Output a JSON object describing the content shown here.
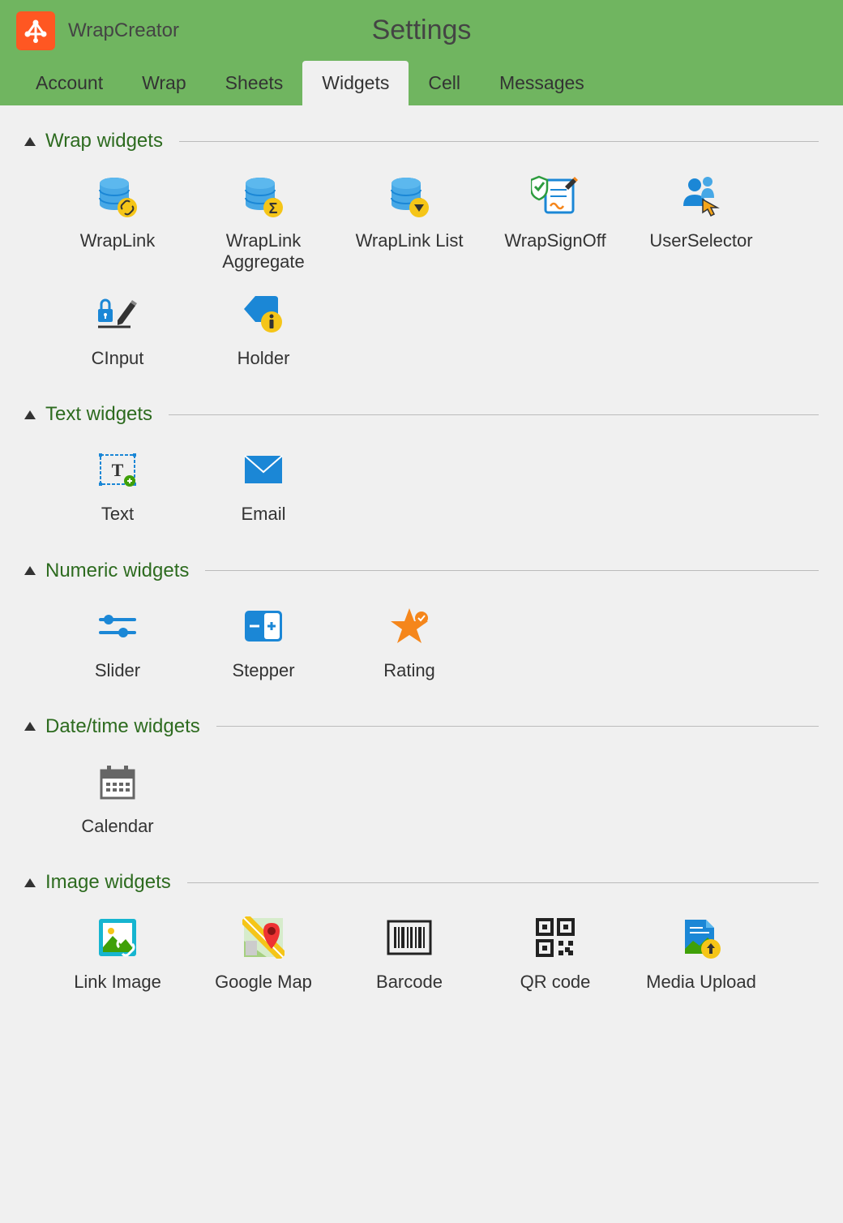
{
  "header": {
    "app_name": "WrapCreator",
    "page_title": "Settings"
  },
  "tabs": [
    {
      "label": "Account",
      "active": false
    },
    {
      "label": "Wrap",
      "active": false
    },
    {
      "label": "Sheets",
      "active": false
    },
    {
      "label": "Widgets",
      "active": true
    },
    {
      "label": "Cell",
      "active": false
    },
    {
      "label": "Messages",
      "active": false
    }
  ],
  "sections": [
    {
      "title": "Wrap widgets",
      "widgets": [
        {
          "label": "WrapLink",
          "icon": "wraplink"
        },
        {
          "label": "WrapLink Aggregate",
          "icon": "wraplink-aggregate"
        },
        {
          "label": "WrapLink List",
          "icon": "wraplink-list"
        },
        {
          "label": "WrapSignOff",
          "icon": "wrapsignoff"
        },
        {
          "label": "UserSelector",
          "icon": "userselector"
        },
        {
          "label": "CInput",
          "icon": "cinput"
        },
        {
          "label": "Holder",
          "icon": "holder"
        }
      ]
    },
    {
      "title": "Text widgets",
      "widgets": [
        {
          "label": "Text",
          "icon": "text"
        },
        {
          "label": "Email",
          "icon": "email"
        }
      ]
    },
    {
      "title": "Numeric widgets",
      "widgets": [
        {
          "label": "Slider",
          "icon": "slider"
        },
        {
          "label": "Stepper",
          "icon": "stepper"
        },
        {
          "label": "Rating",
          "icon": "rating"
        }
      ]
    },
    {
      "title": "Date/time widgets",
      "widgets": [
        {
          "label": "Calendar",
          "icon": "calendar"
        }
      ]
    },
    {
      "title": "Image widgets",
      "widgets": [
        {
          "label": "Link Image",
          "icon": "linkimage"
        },
        {
          "label": "Google Map",
          "icon": "googlemap"
        },
        {
          "label": "Barcode",
          "icon": "barcode"
        },
        {
          "label": "QR code",
          "icon": "qrcode"
        },
        {
          "label": "Media Upload",
          "icon": "mediaupload"
        }
      ]
    }
  ]
}
